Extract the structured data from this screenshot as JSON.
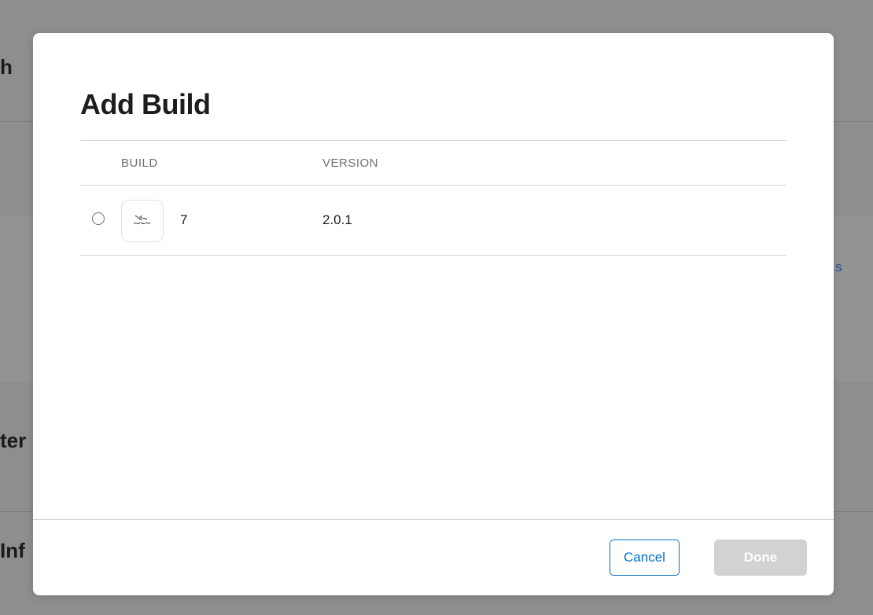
{
  "background": {
    "fragment_top": "h",
    "fragment_middle": "ter",
    "fragment_bottom": "Inf",
    "fragment_link": "s"
  },
  "modal": {
    "title": "Add Build",
    "columns": {
      "build": "BUILD",
      "version": "VERSION"
    },
    "rows": [
      {
        "build": "7",
        "version": "2.0.1",
        "icon": "app-icon",
        "selected": false
      }
    ],
    "buttons": {
      "cancel": "Cancel",
      "done": "Done"
    }
  },
  "colors": {
    "accent": "#0070c9",
    "disabled_button": "#d2d2d2",
    "overlay": "#8e8e8e"
  }
}
